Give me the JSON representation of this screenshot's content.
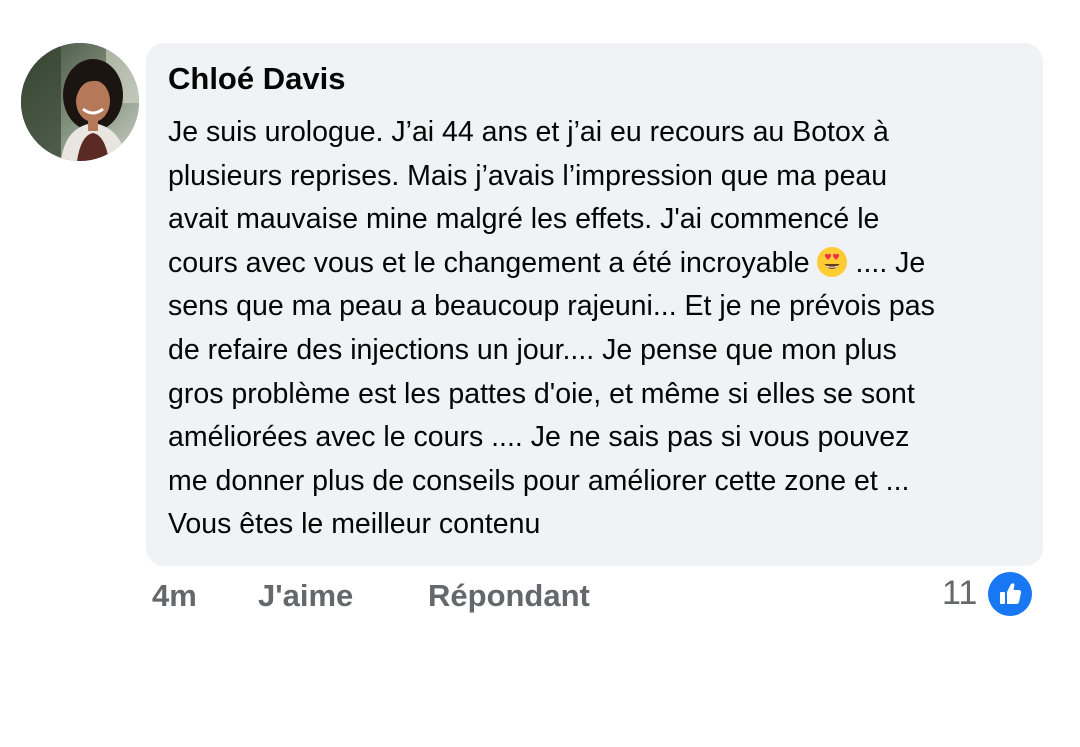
{
  "comment": {
    "author": "Chloé Davis",
    "body_lines": [
      "Je suis urologue. J’ai 44 ans et j’ai eu recours au Botox à",
      "plusieurs reprises. Mais j’avais l’impression que ma peau",
      "avait mauvaise mine malgré les effets. J'ai commencé le",
      "cours avec vous et le changement a été incroyable",
      " .... Je",
      "sens que ma peau a beaucoup rajeuni... Et je ne prévois pas",
      "de refaire des injections un jour.... Je pense que mon plus",
      "gros problème est les pattes d'oie, et même si elles se sont",
      "améliorées avec le cours .... Je ne sais pas si vous pouvez",
      "me donner plus de conseils pour améliorer cette zone et ...",
      "Vous êtes le meilleur contenu"
    ],
    "emoji": "heart-eyes-emoji"
  },
  "actions": {
    "time": "4m",
    "like_label": "J'aime",
    "reply_label": "Répondant"
  },
  "reactions": {
    "count": "11",
    "icon": "thumbs-up-icon",
    "accent": "#1877f2"
  }
}
